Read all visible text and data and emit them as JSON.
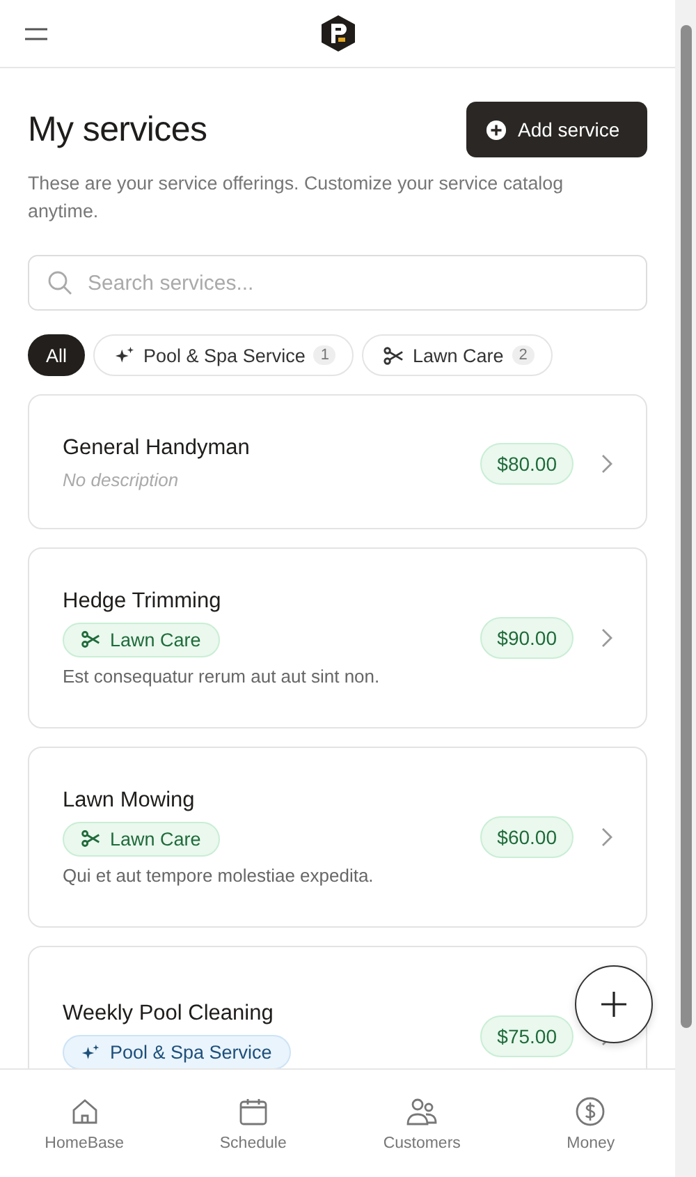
{
  "page": {
    "title": "My services",
    "subtitle": "These are your service offerings. Customize your service catalog anytime.",
    "add_button": "Add service"
  },
  "search": {
    "placeholder": "Search services..."
  },
  "filters": [
    {
      "label": "All",
      "kind": "none",
      "selected": true
    },
    {
      "label": "Pool & Spa Service",
      "kind": "sparkles",
      "count": "1",
      "selected": false
    },
    {
      "label": "Lawn Care",
      "kind": "scissors",
      "count": "2",
      "selected": false
    }
  ],
  "services": [
    {
      "name": "General Handyman",
      "description": "No description",
      "description_empty": true,
      "price": "$80.00"
    },
    {
      "name": "Hedge Trimming",
      "tag": {
        "label": "Lawn Care",
        "kind": "scissors"
      },
      "description": "Est consequatur rerum aut aut sint non.",
      "description_empty": false,
      "price": "$90.00"
    },
    {
      "name": "Lawn Mowing",
      "tag": {
        "label": "Lawn Care",
        "kind": "scissors"
      },
      "description": "Qui et aut tempore molestiae expedita.",
      "description_empty": false,
      "price": "$60.00"
    },
    {
      "name": "Weekly Pool Cleaning",
      "tag": {
        "label": "Pool & Spa Service",
        "kind": "sparkles"
      },
      "price": "$75.00"
    }
  ],
  "bottom_nav": [
    {
      "label": "HomeBase",
      "kind": "home"
    },
    {
      "label": "Schedule",
      "kind": "calendar"
    },
    {
      "label": "Customers",
      "kind": "people"
    },
    {
      "label": "Money",
      "kind": "dollar"
    }
  ]
}
